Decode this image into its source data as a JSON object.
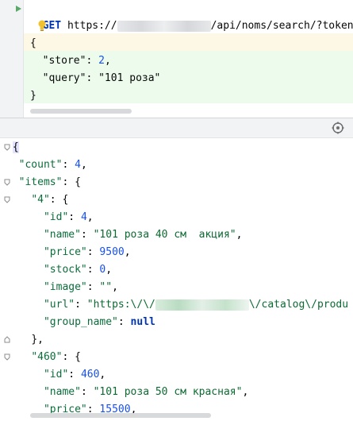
{
  "request": {
    "method": "GET",
    "url_prefix": "https://",
    "url_suffix": "/api/noms/search/?token=s",
    "body_open": "{",
    "body_close": "}",
    "body": [
      {
        "key": "\"store\"",
        "sep": ": ",
        "value": "2",
        "trail": ","
      },
      {
        "key": "\"query\"",
        "sep": ": ",
        "value": "\"101 роза\"",
        "trail": ""
      }
    ]
  },
  "icons": {
    "request_run": "play-icon",
    "hint": "lightbulb-icon",
    "settings": "settings-icon"
  },
  "response": {
    "open": "{",
    "count_key": "\"count\"",
    "count_val": "4",
    "items_key": "\"items\"",
    "items_open": "{",
    "item1": {
      "key": "\"4\"",
      "open": "{",
      "id_key": "\"id\"",
      "id_val": "4",
      "name_key": "\"name\"",
      "name_val": "\"101 роза 40 см  акция\"",
      "price_key": "\"price\"",
      "price_val": "9500",
      "stock_key": "\"stock\"",
      "stock_val": "0",
      "image_key": "\"image\"",
      "image_val": "\"\"",
      "url_key": "\"url\"",
      "url_val_prefix": "\"https:\\/\\/",
      "url_val_suffix": "\\/catalog\\/produ",
      "group_key": "\"group_name\"",
      "group_val": "null",
      "close": "},"
    },
    "item2": {
      "key": "\"460\"",
      "open": "{",
      "id_key": "\"id\"",
      "id_val": "460",
      "name_key": "\"name\"",
      "name_val": "\"101 роза 50 см красная\"",
      "price_key": "\"price\"",
      "price_val": "15500"
    }
  },
  "colors": {
    "key": "#0a6e3b",
    "number": "#1750eb",
    "keyword": "#0033b3",
    "request_body_highlight": "#edfbed",
    "warning_highlight": "#fdf8e6"
  }
}
